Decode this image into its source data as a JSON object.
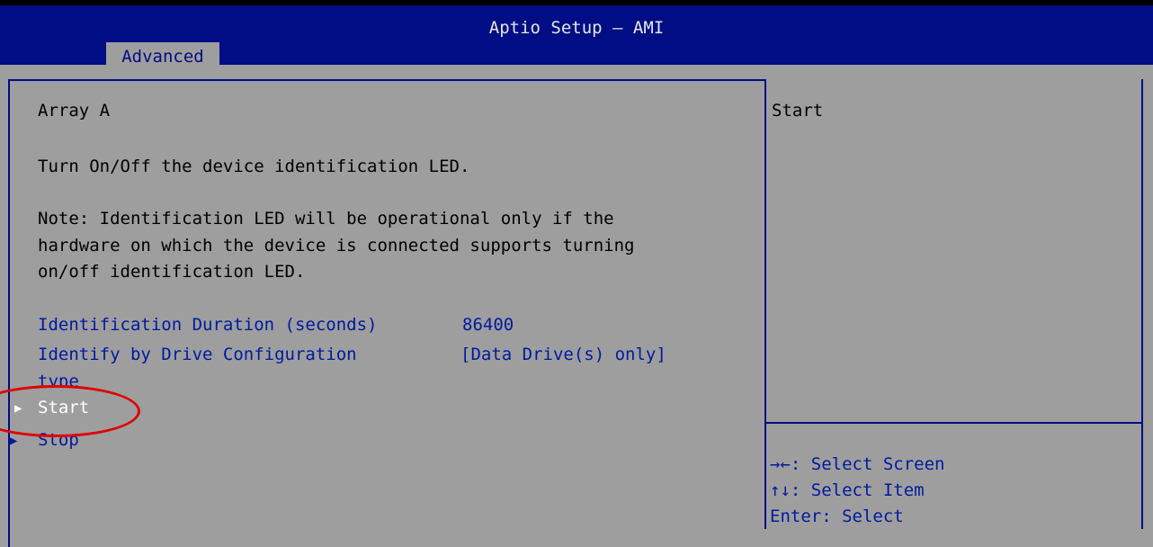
{
  "header": {
    "title": "Aptio Setup – AMI",
    "tab": "Advanced"
  },
  "main": {
    "heading": "Array A",
    "description": "Turn On/Off the device identification LED.",
    "note_lines": [
      "Note: Identification LED will be operational only if the",
      "hardware on which the device is connected supports turning",
      "on/off identification LED."
    ],
    "duration": {
      "label": "Identification Duration (seconds)",
      "value": "86400"
    },
    "identify": {
      "label_line1": "Identify by Drive Configuration",
      "label_line2": "type",
      "value": "[Data Drive(s) only]"
    },
    "start_label": "Start",
    "stop_label": "Stop",
    "arrow_glyph": "▶"
  },
  "help": {
    "text": "Start",
    "keys": [
      {
        "key": "→←",
        "action": ": Select Screen"
      },
      {
        "key": "↑↓",
        "action": ": Select Item"
      },
      {
        "key": "Enter",
        "action": ": Select"
      }
    ]
  },
  "colors": {
    "header_bg": "#000d85",
    "body_bg": "#9e9e9e",
    "highlight_ring": "#e00000"
  }
}
